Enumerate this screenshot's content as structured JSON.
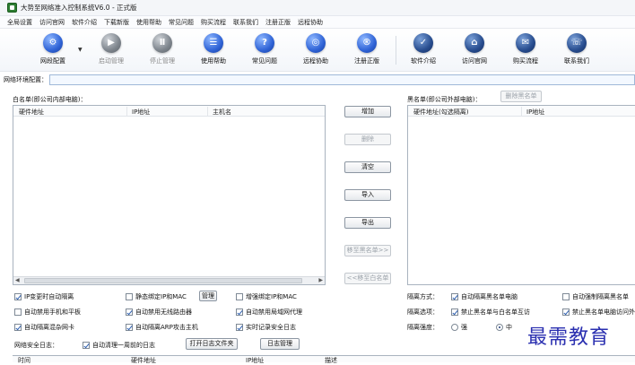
{
  "window": {
    "title": "大势至网络准入控制系统V6.0 - 正式版"
  },
  "menu": [
    "全局设置",
    "访问官网",
    "软件介绍",
    "下载新版",
    "使用帮助",
    "常见问题",
    "购买流程",
    "联系我们",
    "注册正版",
    "远程协助"
  ],
  "toolbar": {
    "items": [
      {
        "label": "网段配置",
        "icon": "gear-icon"
      },
      {
        "label": "启动管理",
        "icon": "play-icon"
      },
      {
        "label": "停止管理",
        "icon": "pause-icon"
      },
      {
        "label": "使用帮助",
        "icon": "help-book-icon"
      },
      {
        "label": "常见问题",
        "icon": "question-icon"
      },
      {
        "label": "远程协助",
        "icon": "remote-icon"
      },
      {
        "label": "注册正版",
        "icon": "register-icon"
      },
      {
        "label": "软件介绍",
        "icon": "info-icon"
      },
      {
        "label": "访问官网",
        "icon": "home-icon"
      },
      {
        "label": "购买流程",
        "icon": "cart-icon"
      },
      {
        "label": "联系我们",
        "icon": "contact-icon"
      }
    ]
  },
  "env": {
    "label": "网络环境配置：",
    "value": ""
  },
  "whitelist": {
    "label": "白名单(即公司内部电脑)：",
    "columns": [
      "硬件地址",
      "IP地址",
      "主机名"
    ]
  },
  "blacklist": {
    "label": "黑名单(即公司外部电脑)：",
    "delete_btn": "删除黑名单",
    "columns": [
      "硬件地址(勾选隔离)",
      "IP地址"
    ]
  },
  "buttons": {
    "add": "增加",
    "remove": "删除",
    "clear": "清空",
    "import": "导入",
    "export": "导出",
    "to_black": "移至黑名单>>",
    "to_white": "<<移至白名单"
  },
  "options": {
    "o1": "IP变更时自动隔离",
    "o2": "静态绑定IP和MAC",
    "manage": "管理",
    "o3": "增强绑定IP和MAC",
    "o4": "自动禁用手机和平板",
    "o5": "自动禁用无线路由器",
    "o6": "自动禁用局域网代理",
    "o7": "自动隔离混杂网卡",
    "o8": "自动隔离ARP攻击主机",
    "o9": "实时记录安全日志"
  },
  "isolation": {
    "method_label": "隔离方式：",
    "method_1": "自动隔离黑名单电脑",
    "method_2": "自动强制隔离黑名单",
    "options_label": "隔离选项：",
    "options_1": "禁止黑名单与白名单互访",
    "options_2": "禁止黑名单电脑访问外",
    "strength_label": "隔离强度：",
    "strong": "强",
    "medium": "中"
  },
  "log": {
    "label": "网络安全日志：",
    "auto_clear": "自动清理一周前的日志",
    "open_folder": "打开日志文件夹",
    "manage": "日志管理",
    "columns": [
      "时间",
      "硬件地址",
      "IP地址",
      "描述"
    ]
  },
  "watermark": "最需教育"
}
